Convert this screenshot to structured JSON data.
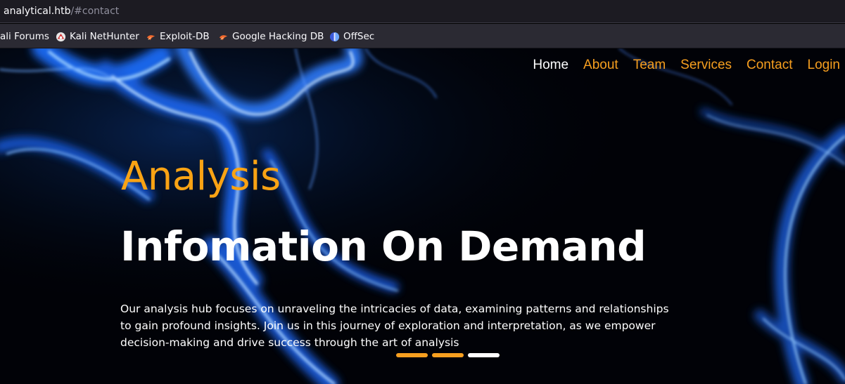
{
  "browser": {
    "url_host": "analytical.htb",
    "url_path": "/#contact",
    "bookmarks": [
      {
        "label": "ali Forums",
        "icon": "kali-forums-icon"
      },
      {
        "label": "Kali NetHunter",
        "icon": "kali-nethunter-icon"
      },
      {
        "label": "Exploit-DB",
        "icon": "exploit-db-icon"
      },
      {
        "label": "Google Hacking DB",
        "icon": "google-hacking-db-icon"
      },
      {
        "label": "OffSec",
        "icon": "offsec-icon"
      }
    ]
  },
  "nav": {
    "items": [
      {
        "label": "Home",
        "active": true
      },
      {
        "label": "About",
        "active": false
      },
      {
        "label": "Team",
        "active": false
      },
      {
        "label": "Services",
        "active": false
      },
      {
        "label": "Contact",
        "active": false
      },
      {
        "label": "Login",
        "active": false
      }
    ]
  },
  "hero": {
    "kicker": "Analysis",
    "headline": "Infomation On Demand",
    "description": "Our analysis hub focuses on unraveling the intricacies of data, examining patterns and relationships to gain profound insights. Join us in this journey of exploration and interpretation, as we empower decision-making and drive success through the art of analysis",
    "slides": [
      {
        "state": "inactive"
      },
      {
        "state": "inactive"
      },
      {
        "state": "active"
      }
    ]
  },
  "colors": {
    "accent": "#f79f1f",
    "nav_active": "#ffffff",
    "indicator_active": "#ffffff",
    "indicator_inactive": "#f79f1f",
    "background": "#02040a",
    "smoke": "#2f8cff"
  }
}
